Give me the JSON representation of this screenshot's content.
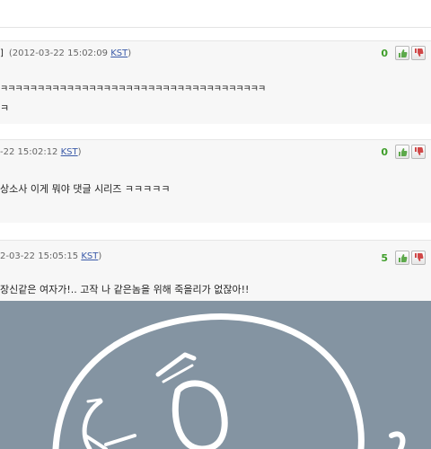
{
  "comments": [
    {
      "timestamp": "(2012-03-22 15:02:09",
      "timezone": "KST",
      "bracket": "]",
      "vote_count": "0",
      "body_line1": "ㅋㅋㅋㅋㅋㅋㅋㅋㅋㅋㅋㅋㅋㅋㅋㅋㅋㅋㅋㅋㅋㅋㅋㅋㅋㅋㅋㅋㅋㅋㅋㅋㅋㅋㅋㅋ",
      "body_line2": "ㅋ"
    },
    {
      "timestamp": "-22 15:02:12",
      "timezone": "KST",
      "vote_count": "0",
      "body_line1": "상소사 이게 뭐야 댓글 시리즈 ㅋㅋㅋㅋㅋ"
    },
    {
      "timestamp": "2-03-22 15:05:15",
      "timezone": "KST",
      "vote_count": "5",
      "body_line1": "장신같은 여자가!.. 고작 나 같은놈을 위해 죽을리가 없잖아!!"
    }
  ],
  "icons": {
    "up": "thumbs-up-icon",
    "down": "thumbs-down-icon"
  },
  "colors": {
    "vote_count": "#3f9e2a",
    "timezone_link": "#3a5aa8",
    "image_bg": "#8494a2"
  }
}
